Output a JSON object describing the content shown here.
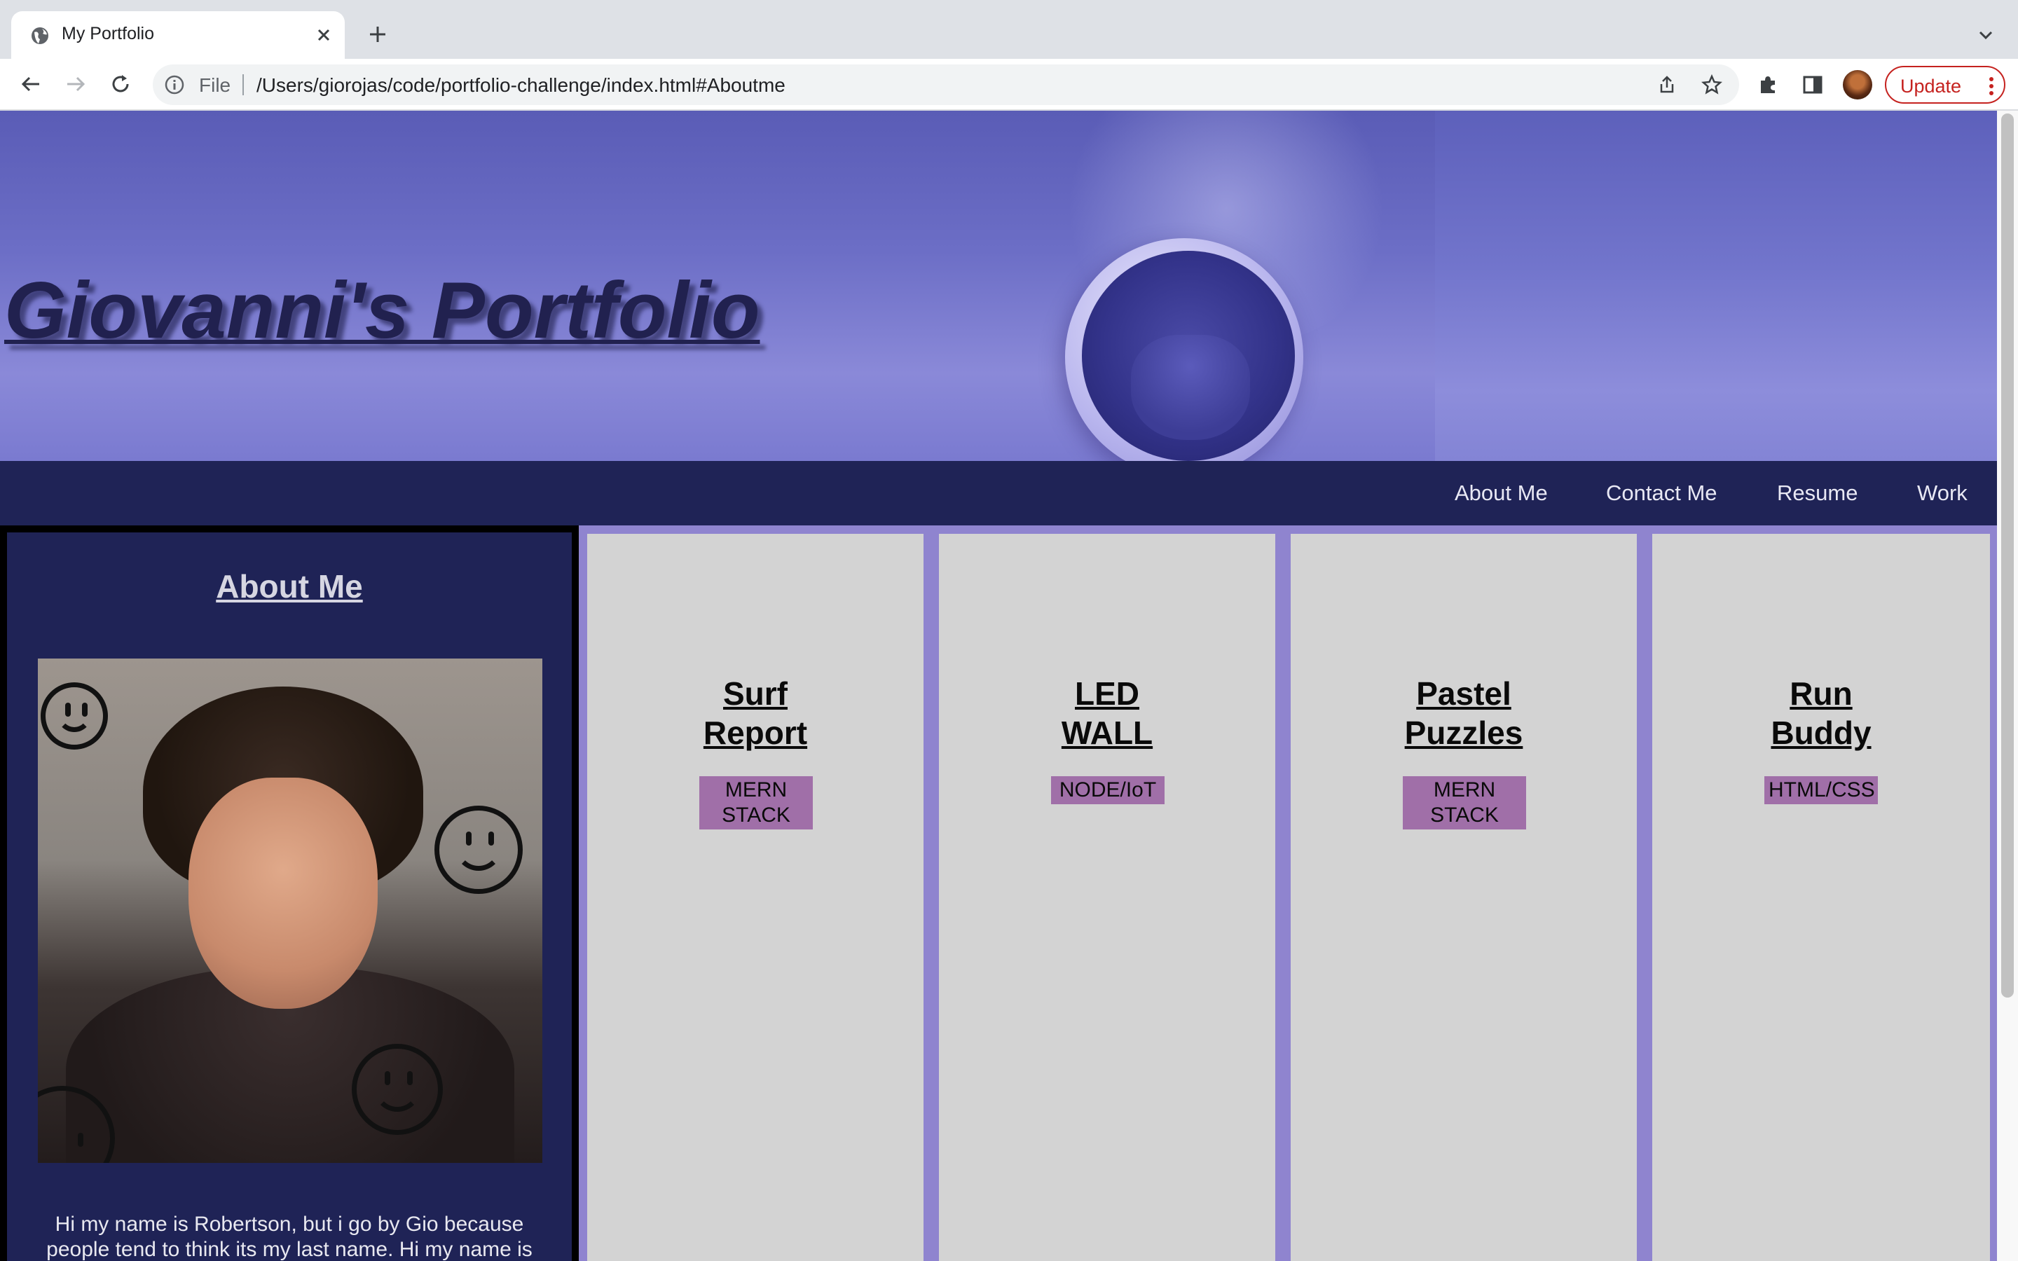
{
  "browser": {
    "tab_title": "My Portfolio",
    "scheme_label": "File",
    "url": "/Users/giorojas/code/portfolio-challenge/index.html#Aboutme",
    "update_label": "Update"
  },
  "header": {
    "title": "Giovanni's Portfolio"
  },
  "nav": {
    "items": [
      {
        "label": "About Me"
      },
      {
        "label": "Contact Me"
      },
      {
        "label": "Resume"
      },
      {
        "label": "Work"
      }
    ]
  },
  "about": {
    "heading": "About Me",
    "bio": "Hi my name is Robertson, but i go by Gio because people tend to think its my last name. Hi my name is"
  },
  "projects": [
    {
      "title_line1": "Surf",
      "title_line2": "Report",
      "tag_line1": "MERN",
      "tag_line2": "STACK"
    },
    {
      "title_line1": "LED",
      "title_line2": "WALL",
      "tag_line1": "NODE/IoT",
      "tag_line2": ""
    },
    {
      "title_line1": "Pastel",
      "title_line2": "Puzzles",
      "tag_line1": "MERN",
      "tag_line2": "STACK"
    },
    {
      "title_line1": "Run",
      "title_line2": "Buddy",
      "tag_line1": "HTML/CSS",
      "tag_line2": ""
    }
  ],
  "colors": {
    "nav_bg": "#1f2356",
    "page_bg": "#8f84cf",
    "card_bg": "#d3d3d3",
    "tag_bg": "#a06fa8",
    "update_red": "#c5221f"
  }
}
